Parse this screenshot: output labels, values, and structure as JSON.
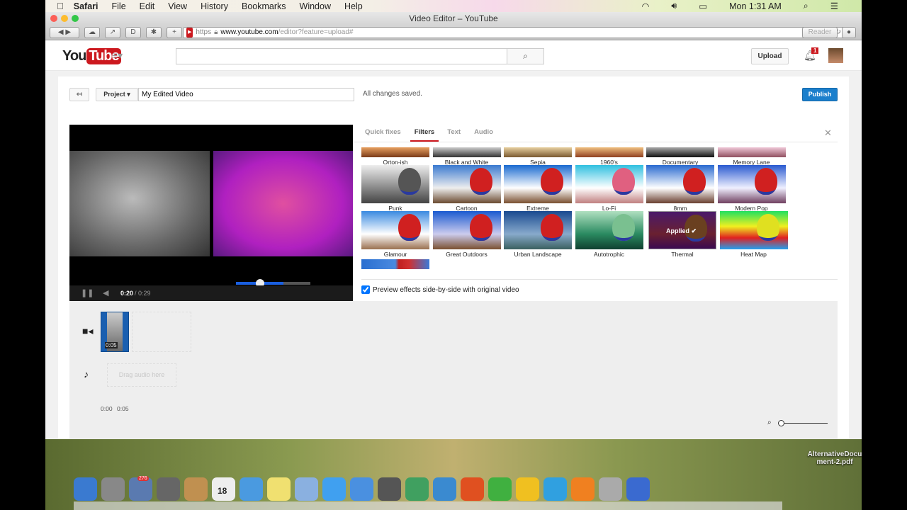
{
  "menubar": {
    "app": "Safari",
    "items": [
      "File",
      "Edit",
      "View",
      "History",
      "Bookmarks",
      "Window",
      "Help"
    ],
    "clock": "Mon 1:31 AM"
  },
  "window": {
    "title": "Video Editor – YouTube"
  },
  "browser": {
    "scheme": "https",
    "domain": "www.youtube.com",
    "path": "/editor?feature=upload#",
    "reader": "Reader"
  },
  "youtube": {
    "logo_you": "You",
    "logo_tube": "Tube",
    "search_placeholder": "",
    "upload": "Upload",
    "notifications": "1"
  },
  "editor": {
    "project_label": "Project",
    "project_name": "My Edited Video",
    "save_status": "All changes saved.",
    "publish": "Publish",
    "player": {
      "current": "0:20",
      "duration": "/ 0:29",
      "progress": 0.69
    },
    "tabs": [
      "Quick fixes",
      "Filters",
      "Text",
      "Audio"
    ],
    "active_tab": "Filters",
    "filters": [
      "Orton-ish",
      "Black and White",
      "Sepia",
      "1960's",
      "Documentary",
      "Memory Lane",
      "Punk",
      "Cartoon",
      "Extreme",
      "Lo-Fi",
      "8mm",
      "Modern Pop",
      "Glamour",
      "Great Outdoors",
      "Urban Landscape",
      "Autotrophic",
      "Thermal",
      "Heat Map"
    ],
    "applied_filter": "Thermal",
    "applied_label": "Applied",
    "preview_checkbox": {
      "label": "Preview effects side-by-side with original video",
      "checked": true
    },
    "timeline": {
      "clip_duration": "0:05",
      "audio_placeholder": "Drag audio here",
      "ticks": [
        "0:00",
        "0:05"
      ]
    }
  },
  "dock": {
    "badges": {
      "mail": "276"
    },
    "calendar_day": "18",
    "file_label": "AlternativeDocument-2.pdf"
  },
  "colors": {
    "accent": "#cc181e",
    "publish": "#1b7fcc",
    "progress": "#1a5fe0"
  }
}
